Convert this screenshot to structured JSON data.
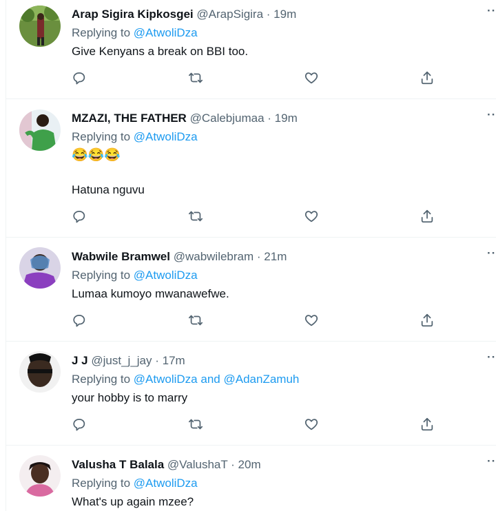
{
  "common": {
    "replying_prefix": "Replying to",
    "and_word": "and",
    "more": "···"
  },
  "tweets": [
    {
      "name": "Arap Sigira Kipkosgei",
      "handle": "@ArapSigira",
      "time": "· 19m",
      "mentions": [
        "@AtwoliDza"
      ],
      "lines": [
        "Give Kenyans a break on BBI too."
      ]
    },
    {
      "name": "MZAZI, THE FATHER",
      "handle": "@Calebjumaa",
      "time": "· 19m",
      "mentions": [
        "@AtwoliDza"
      ],
      "emoji": "😂😂😂",
      "lines": [
        "Hatuna nguvu"
      ]
    },
    {
      "name": "Wabwile Bramwel",
      "handle": "@wabwilebram",
      "time": "· 21m",
      "mentions": [
        "@AtwoliDza"
      ],
      "lines": [
        "Lumaa kumoyo mwanawefwe."
      ]
    },
    {
      "name": "J J",
      "handle": "@just_j_jay",
      "time": "· 17m",
      "mentions": [
        "@AtwoliDza",
        "@AdanZamuh"
      ],
      "lines": [
        "your hobby is to marry"
      ]
    },
    {
      "name": "Valusha T Balala",
      "handle": "@ValushaT",
      "time": "· 20m",
      "mentions": [
        "@AtwoliDza"
      ],
      "lines": [
        "What's up again mzee?"
      ]
    }
  ],
  "icons": {
    "reply": "reply-icon",
    "retweet": "retweet-icon",
    "like": "heart-icon",
    "share": "share-icon",
    "more": "more-icon"
  },
  "colors": {
    "accent": "#1d9bf0",
    "muted": "#536471",
    "text": "#0f1419",
    "border": "#eff3f4"
  }
}
